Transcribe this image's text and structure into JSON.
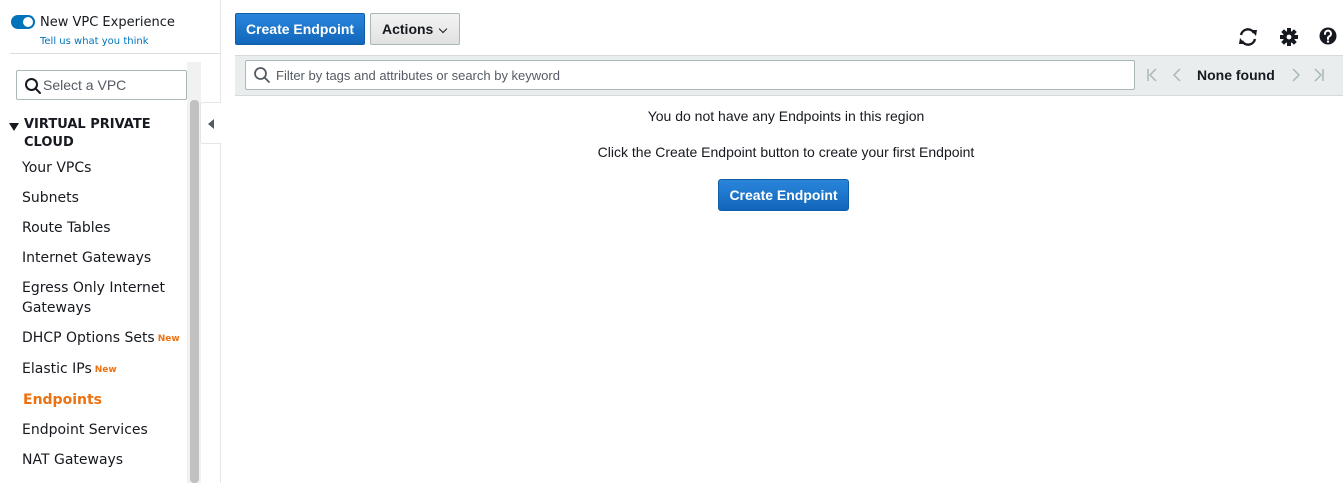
{
  "vpc_experience": {
    "title": "New VPC Experience",
    "feedback_link": "Tell us what you think",
    "enabled": true
  },
  "vpc_filter": {
    "placeholder": "Select a VPC"
  },
  "sidebar": {
    "section_title_line1": "VIRTUAL PRIVATE",
    "section_title_line2": "CLOUD",
    "items": [
      {
        "label": "Your VPCs"
      },
      {
        "label": "Subnets"
      },
      {
        "label": "Route Tables"
      },
      {
        "label": "Internet Gateways"
      },
      {
        "label": "Egress Only Internet",
        "label2": "Gateways"
      },
      {
        "label": "DHCP Options Sets",
        "badge": "New"
      },
      {
        "label": "Elastic IPs",
        "badge": "New"
      },
      {
        "label": "Endpoints",
        "active": true
      },
      {
        "label": "Endpoint Services"
      },
      {
        "label": "NAT Gateways"
      }
    ]
  },
  "toolbar": {
    "create_label": "Create Endpoint",
    "actions_label": "Actions"
  },
  "filter": {
    "placeholder": "Filter by tags and attributes or search by keyword"
  },
  "pager": {
    "status": "None found"
  },
  "empty_state": {
    "message": "You do not have any Endpoints in this region",
    "hint": "Click the Create Endpoint button to create your first Endpoint",
    "create_label": "Create Endpoint"
  },
  "colors": {
    "primary": "#0972d3",
    "active_nav": "#ec7211",
    "badge": "#ec7211",
    "link": "#0073bb"
  }
}
